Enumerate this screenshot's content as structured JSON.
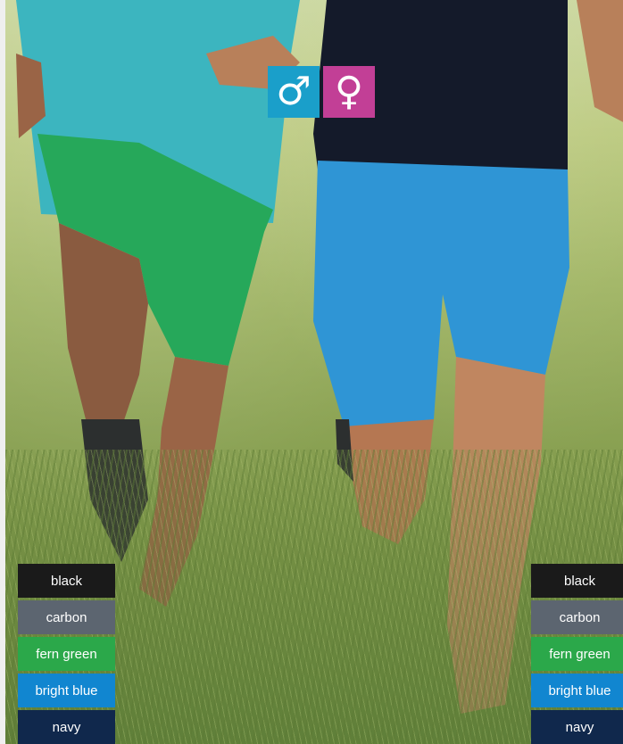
{
  "photo": {
    "subject": "running-couple-in-meadow"
  },
  "gender_selector": [
    {
      "symbol": "♂",
      "icon": "male-icon",
      "color": "#1a9fca"
    },
    {
      "symbol": "♀",
      "icon": "female-icon",
      "color": "#c23f96"
    }
  ],
  "colors_left": [
    {
      "label": "black",
      "color": "#1a1a1a"
    },
    {
      "label": "carbon",
      "color": "#5c6570"
    },
    {
      "label": "fern green",
      "color": "#2ba84a"
    },
    {
      "label": "bright blue",
      "color": "#1186d0"
    },
    {
      "label": "navy",
      "color": "#10284c"
    }
  ],
  "colors_right": [
    {
      "label": "black",
      "color": "#1a1a1a"
    },
    {
      "label": "carbon",
      "color": "#5c6570"
    },
    {
      "label": "fern green",
      "color": "#2ba84a"
    },
    {
      "label": "bright blue",
      "color": "#1186d0"
    },
    {
      "label": "navy",
      "color": "#10284c"
    }
  ]
}
